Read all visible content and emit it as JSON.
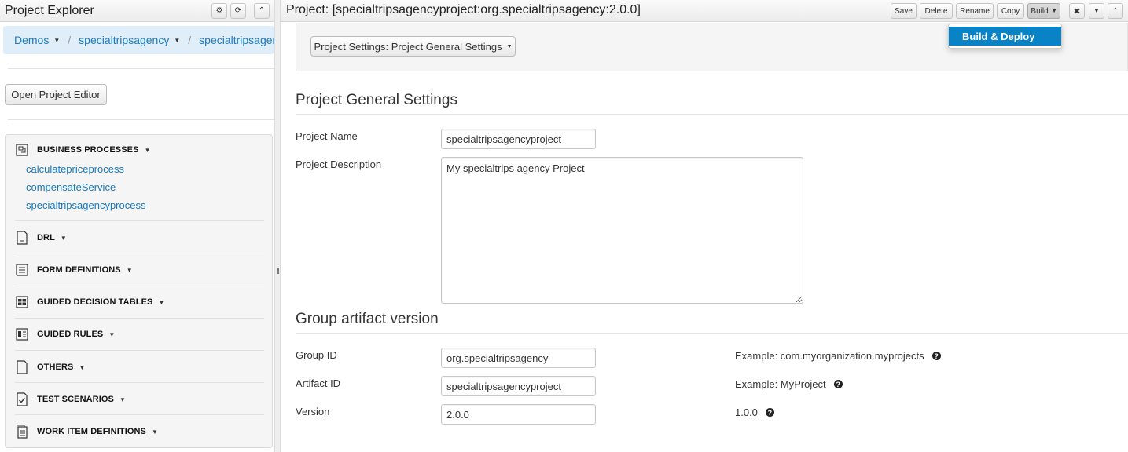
{
  "explorer": {
    "title": "Project Explorer",
    "breadcrumb": [
      "Demos",
      "specialtripsagency",
      "specialtripsagency"
    ],
    "open_editor_label": "Open Project Editor",
    "categories": [
      {
        "label": "BUSINESS PROCESSES",
        "icon": "business-process-icon",
        "items": [
          "calculatepriceprocess",
          "compensateService",
          "specialtripsagencyprocess"
        ]
      },
      {
        "label": "DRL",
        "icon": "drl-file-icon",
        "items": []
      },
      {
        "label": "FORM DEFINITIONS",
        "icon": "form-icon",
        "items": []
      },
      {
        "label": "GUIDED DECISION TABLES",
        "icon": "decision-table-icon",
        "items": []
      },
      {
        "label": "GUIDED RULES",
        "icon": "guided-rule-icon",
        "items": []
      },
      {
        "label": "OTHERS",
        "icon": "document-icon",
        "items": []
      },
      {
        "label": "TEST SCENARIOS",
        "icon": "test-scenario-icon",
        "items": []
      },
      {
        "label": "WORK ITEM DEFINITIONS",
        "icon": "work-item-icon",
        "items": []
      }
    ]
  },
  "editor": {
    "title": "Project: [specialtripsagencyproject:org.specialtripsagency:2.0.0]",
    "toolbar": {
      "save": "Save",
      "delete": "Delete",
      "rename": "Rename",
      "copy": "Copy",
      "build": "Build"
    },
    "build_menu": [
      "Build & Deploy"
    ],
    "settings_dropdown": "Project Settings: Project General Settings",
    "general": {
      "heading": "Project General Settings",
      "name_label": "Project Name",
      "name_value": "specialtripsagencyproject",
      "desc_label": "Project Description",
      "desc_value": "My specialtrips agency Project"
    },
    "gav": {
      "heading": "Group artifact version",
      "group_label": "Group ID",
      "group_value": "org.specialtripsagency",
      "group_hint": "Example: com.myorganization.myprojects",
      "artifact_label": "Artifact ID",
      "artifact_value": "specialtripsagencyproject",
      "artifact_hint": "Example: MyProject",
      "version_label": "Version",
      "version_value": "2.0.0",
      "version_hint": "1.0.0"
    }
  },
  "colors": {
    "link": "#1a7bbf",
    "menu_highlight": "#0a82c6",
    "breadcrumb_bg": "#dfeef8"
  }
}
